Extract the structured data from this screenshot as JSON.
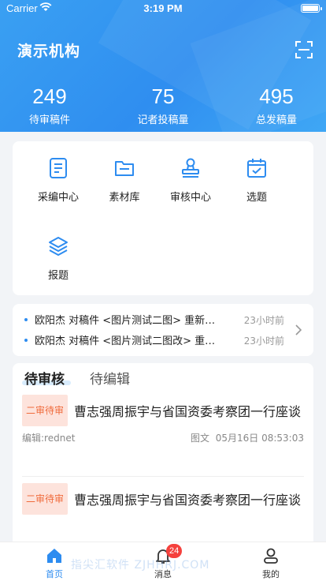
{
  "status_bar": {
    "carrier": "Carrier",
    "time": "3:19 PM"
  },
  "header": {
    "org_name": "演示机构",
    "stats": [
      {
        "value": "249",
        "label": "待审稿件"
      },
      {
        "value": "75",
        "label": "记者投稿量"
      },
      {
        "value": "495",
        "label": "总发稿量"
      }
    ]
  },
  "menu": {
    "items": [
      {
        "label": "采编中心",
        "icon": "document-edit-icon"
      },
      {
        "label": "素材库",
        "icon": "folder-icon"
      },
      {
        "label": "审核中心",
        "icon": "stamp-icon"
      },
      {
        "label": "选题",
        "icon": "calendar-check-icon"
      },
      {
        "label": "报题",
        "icon": "layers-icon"
      }
    ]
  },
  "news": [
    {
      "text": "欧阳杰 对稿件 <图片测试二图> 重新…",
      "time": "23小时前"
    },
    {
      "text": "欧阳杰 对稿件 <图片测试二图改> 重…",
      "time": "23小时前"
    }
  ],
  "tabs": {
    "active": "待审核",
    "inactive": "待编辑"
  },
  "articles": [
    {
      "badge": "二审待审",
      "title": "曹志强周振宇与省国资委考察团一行座谈",
      "editor": "编辑:rednet",
      "type": "图文",
      "date": "05月16日 08:53:03"
    },
    {
      "badge": "二审待审",
      "title": "曹志强周振宇与省国资委考察团一行座谈"
    }
  ],
  "tabbar": {
    "home": "首页",
    "messages": "消息",
    "messages_badge": "24",
    "mine": "我的"
  },
  "watermark": "指尖汇软件 ZJHHRJ.COM",
  "colors": {
    "primary": "#2d8cf0",
    "badge_bg": "#fde3dc",
    "badge_text": "#f06b3c",
    "alert": "#f5413d"
  }
}
